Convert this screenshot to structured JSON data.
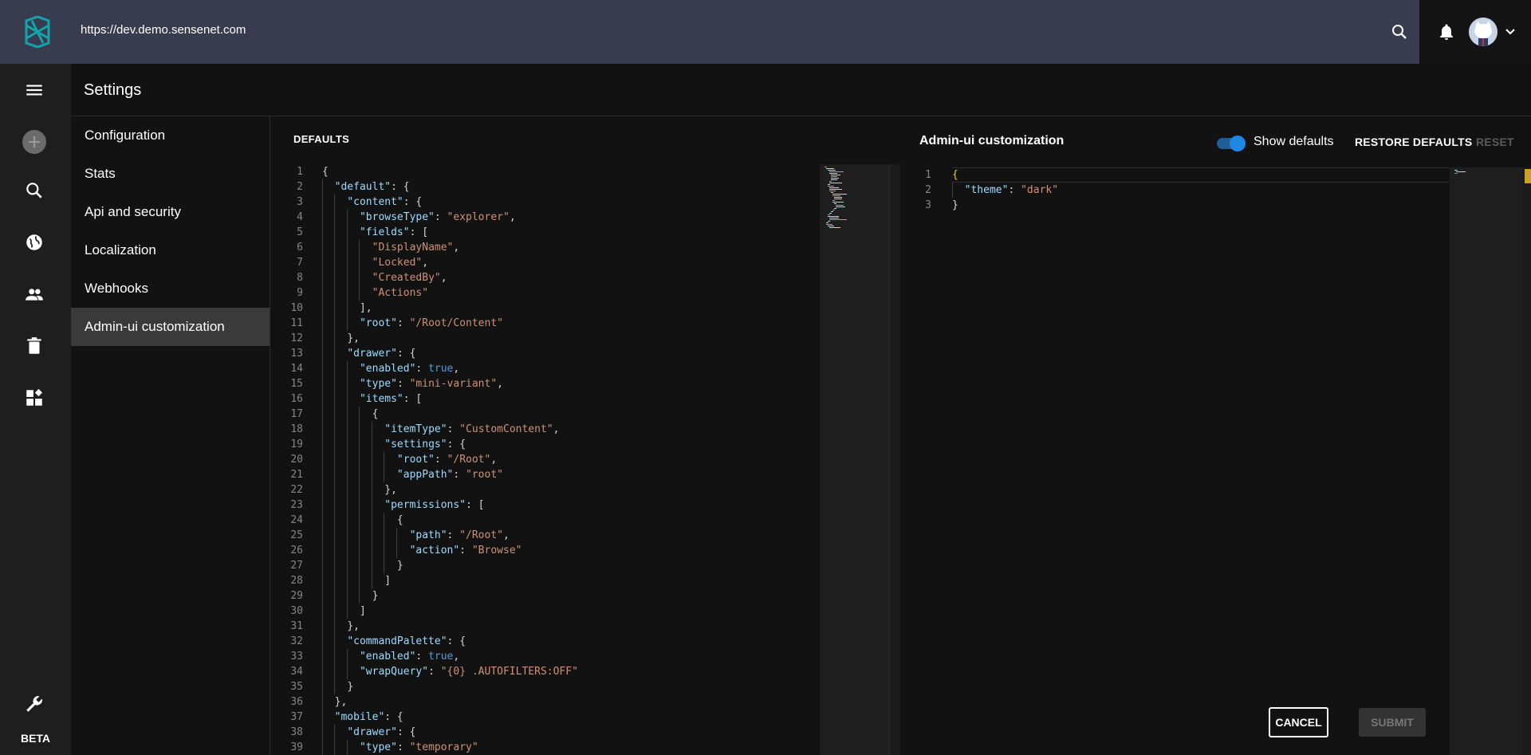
{
  "topbar": {
    "url": "https://dev.demo.sensenet.com",
    "icons": [
      "sensenet-logo-icon",
      "search-icon",
      "bell-icon",
      "avatar",
      "chevron-down-icon"
    ]
  },
  "rail": {
    "icons": [
      "menu-icon",
      "add-icon",
      "search-icon",
      "globe-icon",
      "users-icon",
      "trash-icon",
      "widgets-icon",
      "wrench-icon"
    ],
    "beta_label": "BETA"
  },
  "page": {
    "title": "Settings"
  },
  "settings_nav": {
    "items": [
      {
        "label": "Configuration"
      },
      {
        "label": "Stats"
      },
      {
        "label": "Api and security"
      },
      {
        "label": "Localization"
      },
      {
        "label": "Webhooks"
      },
      {
        "label": "Admin-ui customization",
        "active": true
      }
    ]
  },
  "defaults_panel": {
    "label": "DEFAULTS",
    "line_numbers": [
      "1",
      "2",
      "3",
      "4",
      "5",
      "6",
      "7",
      "8",
      "9",
      "10",
      "11",
      "12",
      "13",
      "14",
      "15",
      "16",
      "17",
      "18",
      "19",
      "20",
      "21",
      "22",
      "23",
      "24",
      "25",
      "26",
      "27",
      "28",
      "29",
      "30",
      "31",
      "32",
      "33",
      "34",
      "35",
      "36",
      "37",
      "38",
      "39"
    ]
  },
  "custom_panel": {
    "title": "Admin-ui customization",
    "toggle_label": "Show defaults",
    "toggle_on": true,
    "restore_label": "RESTORE DEFAULTS",
    "reset_label": "RESET",
    "line_numbers": [
      "1",
      "2",
      "3"
    ],
    "theme_key": "\"theme\"",
    "theme_value": "\"dark\""
  },
  "actions": {
    "cancel_label": "CANCEL",
    "submit_label": "SUBMIT"
  },
  "colors": {
    "topbar": "#373c4f",
    "accent": "#1e88e5",
    "json_key": "#9cdcfe",
    "json_string": "#ce9178",
    "json_bool": "#569cd6"
  }
}
